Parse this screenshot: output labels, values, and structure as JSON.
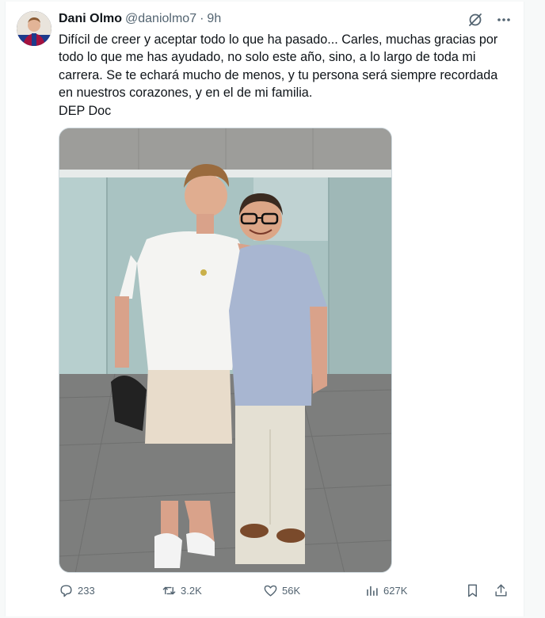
{
  "tweet": {
    "author": {
      "display_name": "Dani Olmo",
      "handle": "@daniolmo7",
      "separator": "·",
      "time": "9h"
    },
    "text": "Difícil de creer y aceptar todo lo que ha pasado... Carles, muchas gracias por todo lo que me has ayudado, no solo este año, sino, a lo largo de toda mi carrera. Se te echará mucho de menos, y tu persona será siempre recordada en nuestros corazones, y en el de mi familia.\nDEP Doc",
    "metrics": {
      "replies": "233",
      "reposts": "3.2K",
      "likes": "56K",
      "views": "627K"
    },
    "icons": {
      "grok": "grok-icon",
      "more": "more-icon",
      "reply": "reply-icon",
      "repost": "repost-icon",
      "like": "heart-icon",
      "views": "views-icon",
      "bookmark": "bookmark-icon",
      "share": "share-icon"
    }
  },
  "colors": {
    "text": "#0f1419",
    "secondary": "#536471",
    "border": "#eff3f4"
  }
}
